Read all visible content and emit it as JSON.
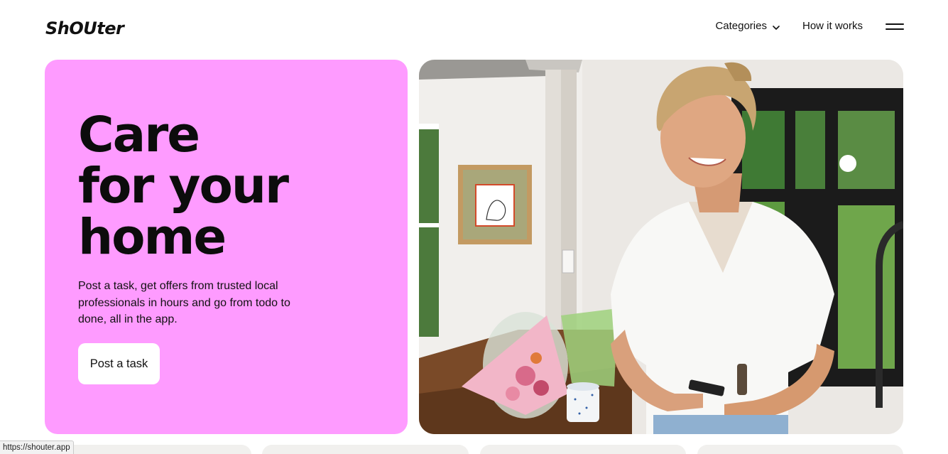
{
  "header": {
    "logo": "ShOUter",
    "nav": {
      "categories_label": "Categories",
      "how_it_works_label": "How it works"
    },
    "icons": {
      "categories_chevron": "chevron-down-icon",
      "menu": "hamburger-menu-icon"
    }
  },
  "hero": {
    "title_lines": [
      "Care",
      "for your",
      "home"
    ],
    "description": "Post a task, get offers from trusted local professionals in hours and go from todo to done, all in the app.",
    "cta_label": "Post a task",
    "background_color": "#fe9bff"
  },
  "status_bar": {
    "url": "https://shouter.app"
  }
}
